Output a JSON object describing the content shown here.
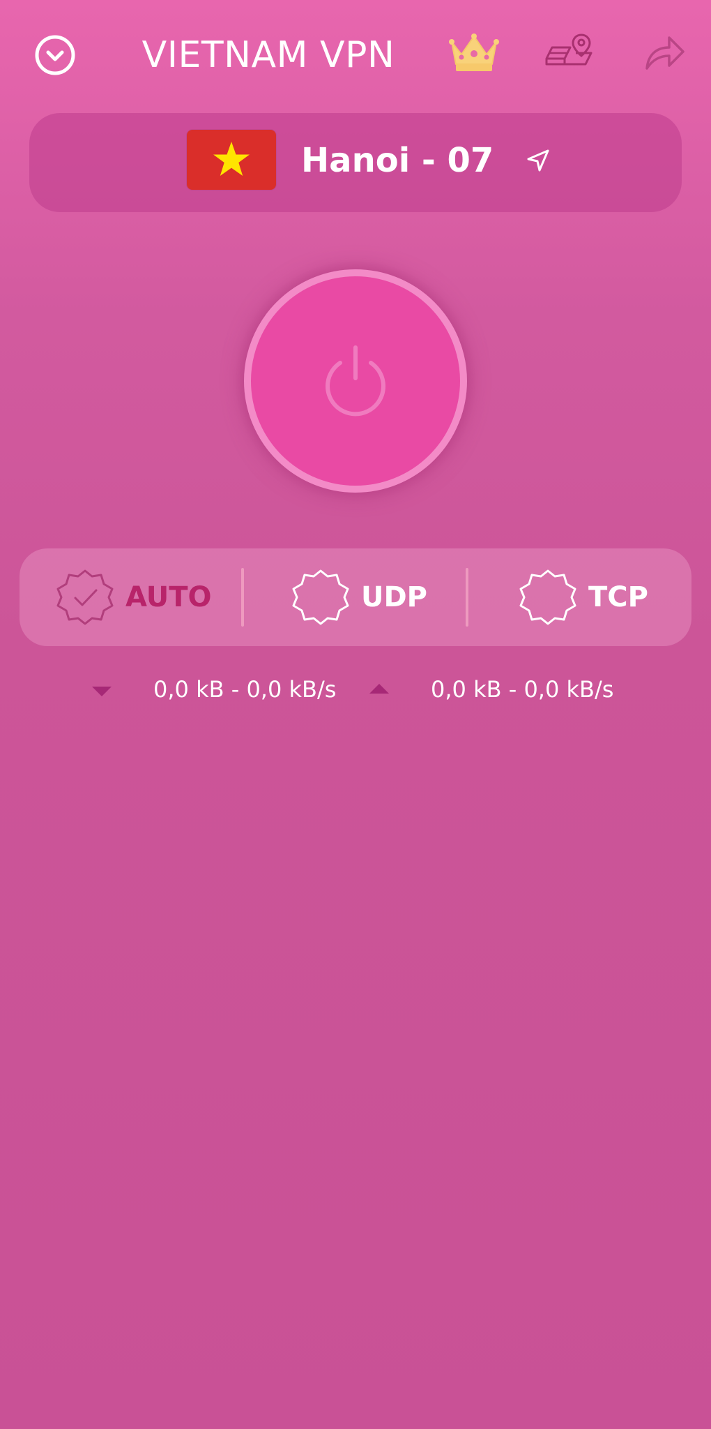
{
  "header": {
    "title": "VIETNAM VPN",
    "menu_icon": "chevron-down-circle-icon",
    "premium_icon": "crown-icon",
    "map_icon": "map-location-icon",
    "share_icon": "share-arrow-icon"
  },
  "server": {
    "name": "Hanoi - 07",
    "flag": "vietnam-flag",
    "flag_colors": {
      "field": "#da2e2a",
      "star": "#ffe400"
    },
    "nav_icon": "navigation-arrow-icon"
  },
  "power": {
    "icon": "power-icon"
  },
  "protocols": [
    {
      "label": "AUTO",
      "selected": true
    },
    {
      "label": "UDP",
      "selected": false
    },
    {
      "label": "TCP",
      "selected": false
    }
  ],
  "traffic": {
    "download": "0,0 kB - 0,0 kB/s",
    "upload": "0,0 kB - 0,0 kB/s"
  },
  "colors": {
    "background": "#cc5598",
    "accent": "#e94aa4",
    "selected_protocol": "#b8246a"
  }
}
